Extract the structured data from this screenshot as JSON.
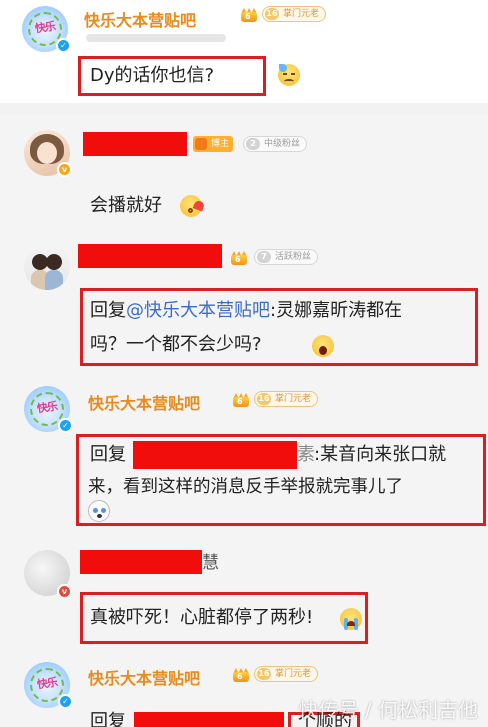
{
  "post": {
    "author": "快乐大本营贴吧",
    "crown_level": "6",
    "fan_badge_level": "16",
    "fan_badge_label": "掌门元老",
    "content": "Dy的话你也信?"
  },
  "replies": [
    {
      "boss_tag": "博主",
      "fan_badge_level": "2",
      "fan_badge_label": "中级粉丝",
      "content": "会播就好"
    },
    {
      "crown_level": "6",
      "fan_badge_level": "7",
      "fan_badge_label": "活跃粉丝",
      "reply_prefix": "回复",
      "mention": "@快乐大本营贴吧",
      "content_line1": ":灵娜嘉昕涛都在",
      "content_line2": "吗？一个都不会少吗?"
    },
    {
      "author": "快乐大本营贴吧",
      "crown_level": "6",
      "fan_badge_level": "16",
      "fan_badge_label": "掌门元老",
      "reply_prefix": "回复",
      "redaction_tail": "素",
      "content_line1": ":某音向来张口就",
      "content_line2": "来，看到这样的消息反手举报就完事儿了"
    },
    {
      "name_suffix": "慧",
      "content": "真被吓死！心脏都停了两秒!"
    },
    {
      "author": "快乐大本营贴吧",
      "crown_level": "6",
      "fan_badge_level": "16",
      "fan_badge_label": "掌门元老",
      "reply_prefix": "回复",
      "content_partial": "个顺的"
    }
  ],
  "watermark": "快传号 / 何松利吉他",
  "colors": {
    "author_orange": "#e98a1c",
    "highlight_red": "#d91f1f",
    "redaction_red": "#f20d0d",
    "mention_blue": "#3a6bc9"
  },
  "icons": [
    "verified-icon",
    "crown-icon",
    "sad-sweat-emoji",
    "kiss-emoji",
    "shocked-emoji",
    "dog-emoji",
    "crying-emoji"
  ]
}
